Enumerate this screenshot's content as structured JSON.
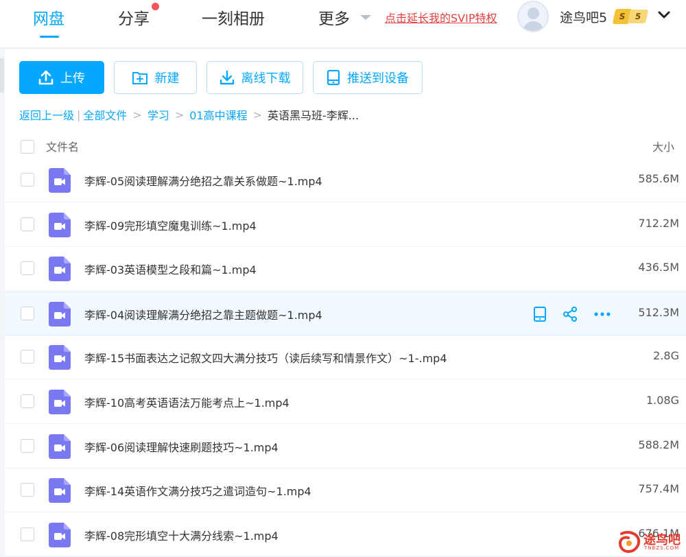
{
  "topnav": {
    "tabs": [
      {
        "label": "网盘",
        "active": true
      },
      {
        "label": "分享",
        "has_dot": true
      },
      {
        "label": "一刻相册"
      },
      {
        "label": "更多"
      }
    ],
    "svip_link": "点击延长我的SVIP特权",
    "username": "途鸟吧5",
    "badge_s": "S",
    "badge_level": "5",
    "accent_color": "#06a7ff",
    "link_color": "#e23f3f"
  },
  "toolbar": {
    "upload": "上传",
    "new": "新建",
    "offline_download": "离线下载",
    "push_to_device": "推送到设备"
  },
  "breadcrumb": {
    "back": "返回上一级",
    "separator_pipe": "|",
    "separator": ">",
    "items": [
      "全部文件",
      "学习",
      "01高中课程"
    ],
    "current": "英语黑马班-李辉..."
  },
  "list_header": {
    "name": "文件名",
    "size": "大小"
  },
  "files": [
    {
      "name": "李辉-05阅读理解满分绝招之靠关系做题~1.mp4",
      "size": "585.6M",
      "icon": "video-file-icon"
    },
    {
      "name": "李辉-09完形填空魔鬼训练~1.mp4",
      "size": "712.2M",
      "icon": "video-file-icon"
    },
    {
      "name": "李辉-03英语模型之段和篇~1.mp4",
      "size": "436.5M",
      "icon": "video-file-icon"
    },
    {
      "name": "李辉-04阅读理解满分绝招之靠主题做题~1.mp4",
      "size": "512.3M",
      "icon": "video-file-icon",
      "hovered": true
    },
    {
      "name": "李辉-15书面表达之记叙文四大满分技巧（读后续写和情景作文）~1-.mp4",
      "size": "2.8G",
      "icon": "video-file-icon"
    },
    {
      "name": "李辉-10高考英语语法万能考点上~1.mp4",
      "size": "1.08G",
      "icon": "video-file-icon"
    },
    {
      "name": "李辉-06阅读理解快速刷题技巧~1.mp4",
      "size": "588.2M",
      "icon": "video-file-icon"
    },
    {
      "name": "李辉-14英语作文满分技巧之遣词造句~1.mp4",
      "size": "757.4M",
      "icon": "video-file-icon"
    },
    {
      "name": "李辉-08完形填空十大满分线索~1.mp4",
      "size": "676.1M",
      "icon": "video-file-icon"
    }
  ],
  "row_actions": [
    "push-device-icon",
    "share-icon",
    "more-icon"
  ],
  "watermark": {
    "text": "途鸟吧",
    "sub": "TNBZS.COM"
  }
}
